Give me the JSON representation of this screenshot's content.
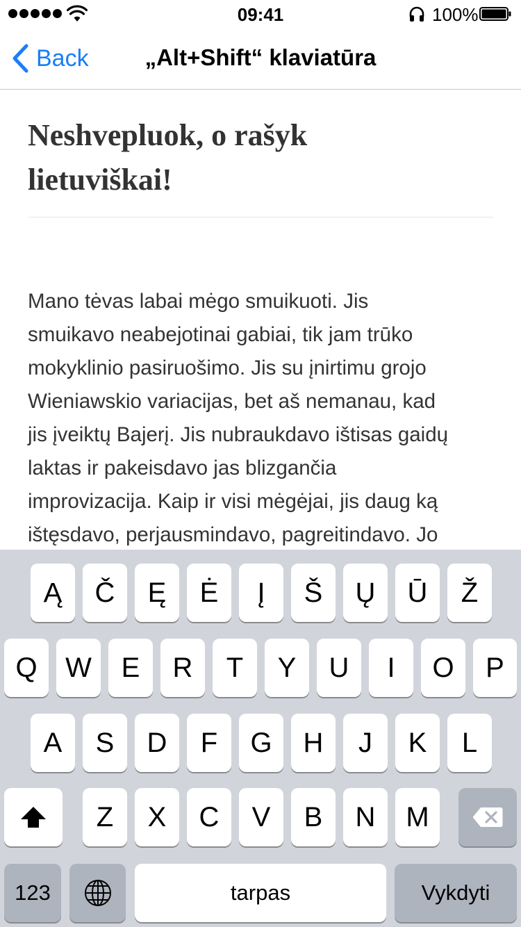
{
  "status_bar": {
    "time": "09:41",
    "battery_percent": "100%",
    "icons": [
      "signal-dots-icon",
      "wifi-icon",
      "headphones-icon",
      "battery-icon"
    ]
  },
  "nav": {
    "back_label": "Back",
    "title": "„Alt+Shift“ klaviatūra"
  },
  "article": {
    "heading": "Neshvepluok, o rašyk lietuviškai!",
    "body": "Mano tėvas labai mėgo smuikuoti. Jis\nsmuikavo neabejotinai gabiai, tik jam trūko\nmokyklinio pasiruošimo. Jis su įnirtimu grojo\nWieniawskio variacijas, bet aš nemanau, kad\njis įveiktų Bajerį. Jis nubraukdavo ištisas gaidų\nlaktas ir pakeisdavo jas blizgančia\nimprovizacija. Kaip ir visi mėgėjai, jis daug ką\ništęsdavo, perjausmindavo, pagreitindavo. Jo"
  },
  "keyboard": {
    "row0": [
      "Ą",
      "Č",
      "Ę",
      "Ė",
      "Į",
      "Š",
      "Ų",
      "Ū",
      "Ž"
    ],
    "row1": [
      "Q",
      "W",
      "E",
      "R",
      "T",
      "Y",
      "U",
      "I",
      "O",
      "P"
    ],
    "row2": [
      "A",
      "S",
      "D",
      "F",
      "G",
      "H",
      "J",
      "K",
      "L"
    ],
    "row3": [
      "Z",
      "X",
      "C",
      "V",
      "B",
      "N",
      "M"
    ],
    "numbers_label": "123",
    "space_label": "tarpas",
    "return_label": "Vykdyti",
    "icons": [
      "shift-icon",
      "backspace-icon",
      "globe-icon"
    ]
  },
  "colors": {
    "accent": "#1a7ef7",
    "keyboard_background": "#d1d5db",
    "special_key": "#aeb4be",
    "body_text": "#333333"
  }
}
